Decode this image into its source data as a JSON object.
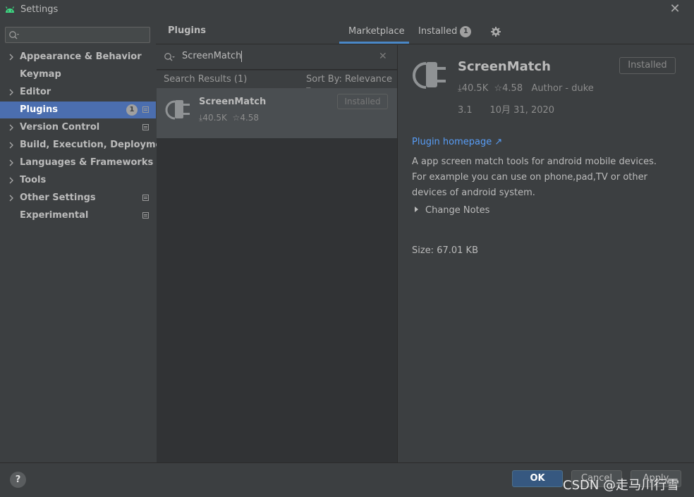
{
  "window": {
    "title": "Settings"
  },
  "sidebar": {
    "items": [
      {
        "label": "Appearance & Behavior",
        "chevron": true
      },
      {
        "label": "Keymap",
        "chevron": false
      },
      {
        "label": "Editor",
        "chevron": true
      },
      {
        "label": "Plugins",
        "chevron": false,
        "badge": "1",
        "selected": true
      },
      {
        "label": "Version Control",
        "chevron": true
      },
      {
        "label": "Build, Execution, Deployment",
        "chevron": true
      },
      {
        "label": "Languages & Frameworks",
        "chevron": true
      },
      {
        "label": "Tools",
        "chevron": true
      },
      {
        "label": "Other Settings",
        "chevron": true
      },
      {
        "label": "Experimental",
        "chevron": false
      }
    ]
  },
  "header": {
    "title": "Plugins",
    "tabs": [
      {
        "label": "Marketplace",
        "active": true
      },
      {
        "label": "Installed",
        "badge": "1"
      }
    ]
  },
  "list": {
    "query": "ScreenMatch",
    "results_label": "Search Results (1)",
    "sort_label": "Sort By: Relevance",
    "items": [
      {
        "name": "ScreenMatch",
        "downloads": "40.5K",
        "rating": "4.58",
        "status": "Installed"
      }
    ]
  },
  "detail": {
    "name": "ScreenMatch",
    "status_button": "Installed",
    "downloads": "40.5K",
    "rating": "4.58",
    "author": "Author - duke",
    "version": "3.1",
    "date": "10月 31, 2020",
    "homepage_label": "Plugin homepage",
    "description": "A app screen match tools for android mobile devices. For example you can use on phone,pad,TV or other devices of android system.",
    "change_notes_label": "Change Notes",
    "size": "Size: 67.01 KB"
  },
  "footer": {
    "help_label": "?",
    "ok_label": "OK",
    "cancel_label": "Cancel",
    "apply_label": "Apply",
    "watermark": "CSDN @走马川行雪"
  },
  "colors": {
    "accent": "#4b6eaf",
    "link": "#589df6",
    "tab_underline": "#4a88c7"
  }
}
